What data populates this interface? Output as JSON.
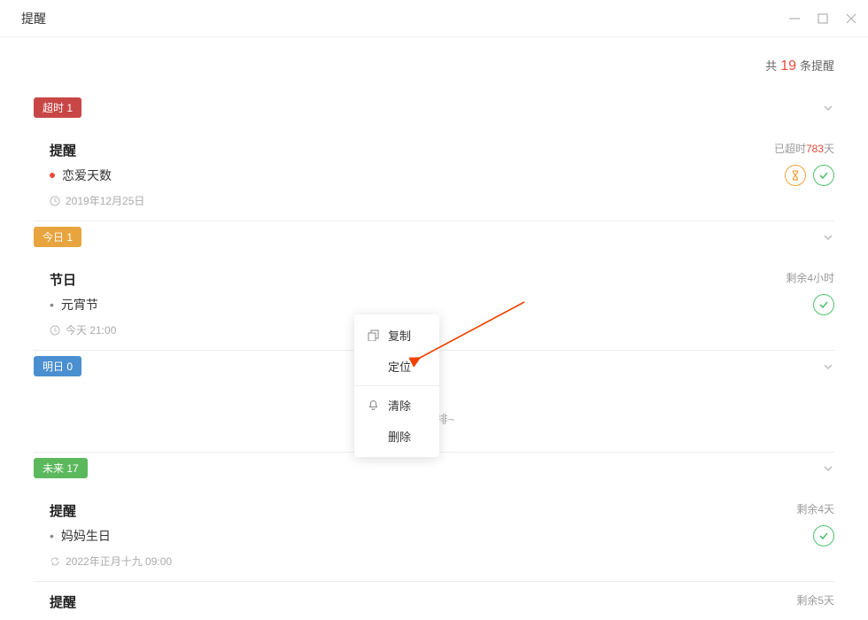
{
  "window": {
    "title": "提醒"
  },
  "summary": {
    "prefix": "共",
    "count": "19",
    "suffix": "条提醒"
  },
  "sections": {
    "overdue": {
      "badge": "超时 1",
      "items": [
        {
          "category": "提醒",
          "title": "恋爱天数",
          "date": "2019年12月25日",
          "status_prefix": "已超时",
          "status_num": "783",
          "status_suffix": "天",
          "dot": "red",
          "show_snooze": true
        }
      ]
    },
    "today": {
      "badge": "今日 1",
      "items": [
        {
          "category": "节日",
          "title": "元宵节",
          "date": "今天 21:00",
          "status": "剩余4小时",
          "dot": "bullet",
          "show_snooze": false
        }
      ]
    },
    "tomorrow": {
      "badge": "明日 0",
      "empty_text": "务安排~"
    },
    "future": {
      "badge": "未来 17",
      "items": [
        {
          "category": "提醒",
          "title": "妈妈生日",
          "date": "2022年正月十九 09:00",
          "status": "剩余4天",
          "dot": "bullet",
          "recurring": true,
          "show_snooze": false
        },
        {
          "category": "提醒",
          "status": "剩余5天"
        }
      ]
    }
  },
  "context_menu": {
    "copy": "复制",
    "locate": "定位",
    "clear": "清除",
    "delete": "删除"
  }
}
